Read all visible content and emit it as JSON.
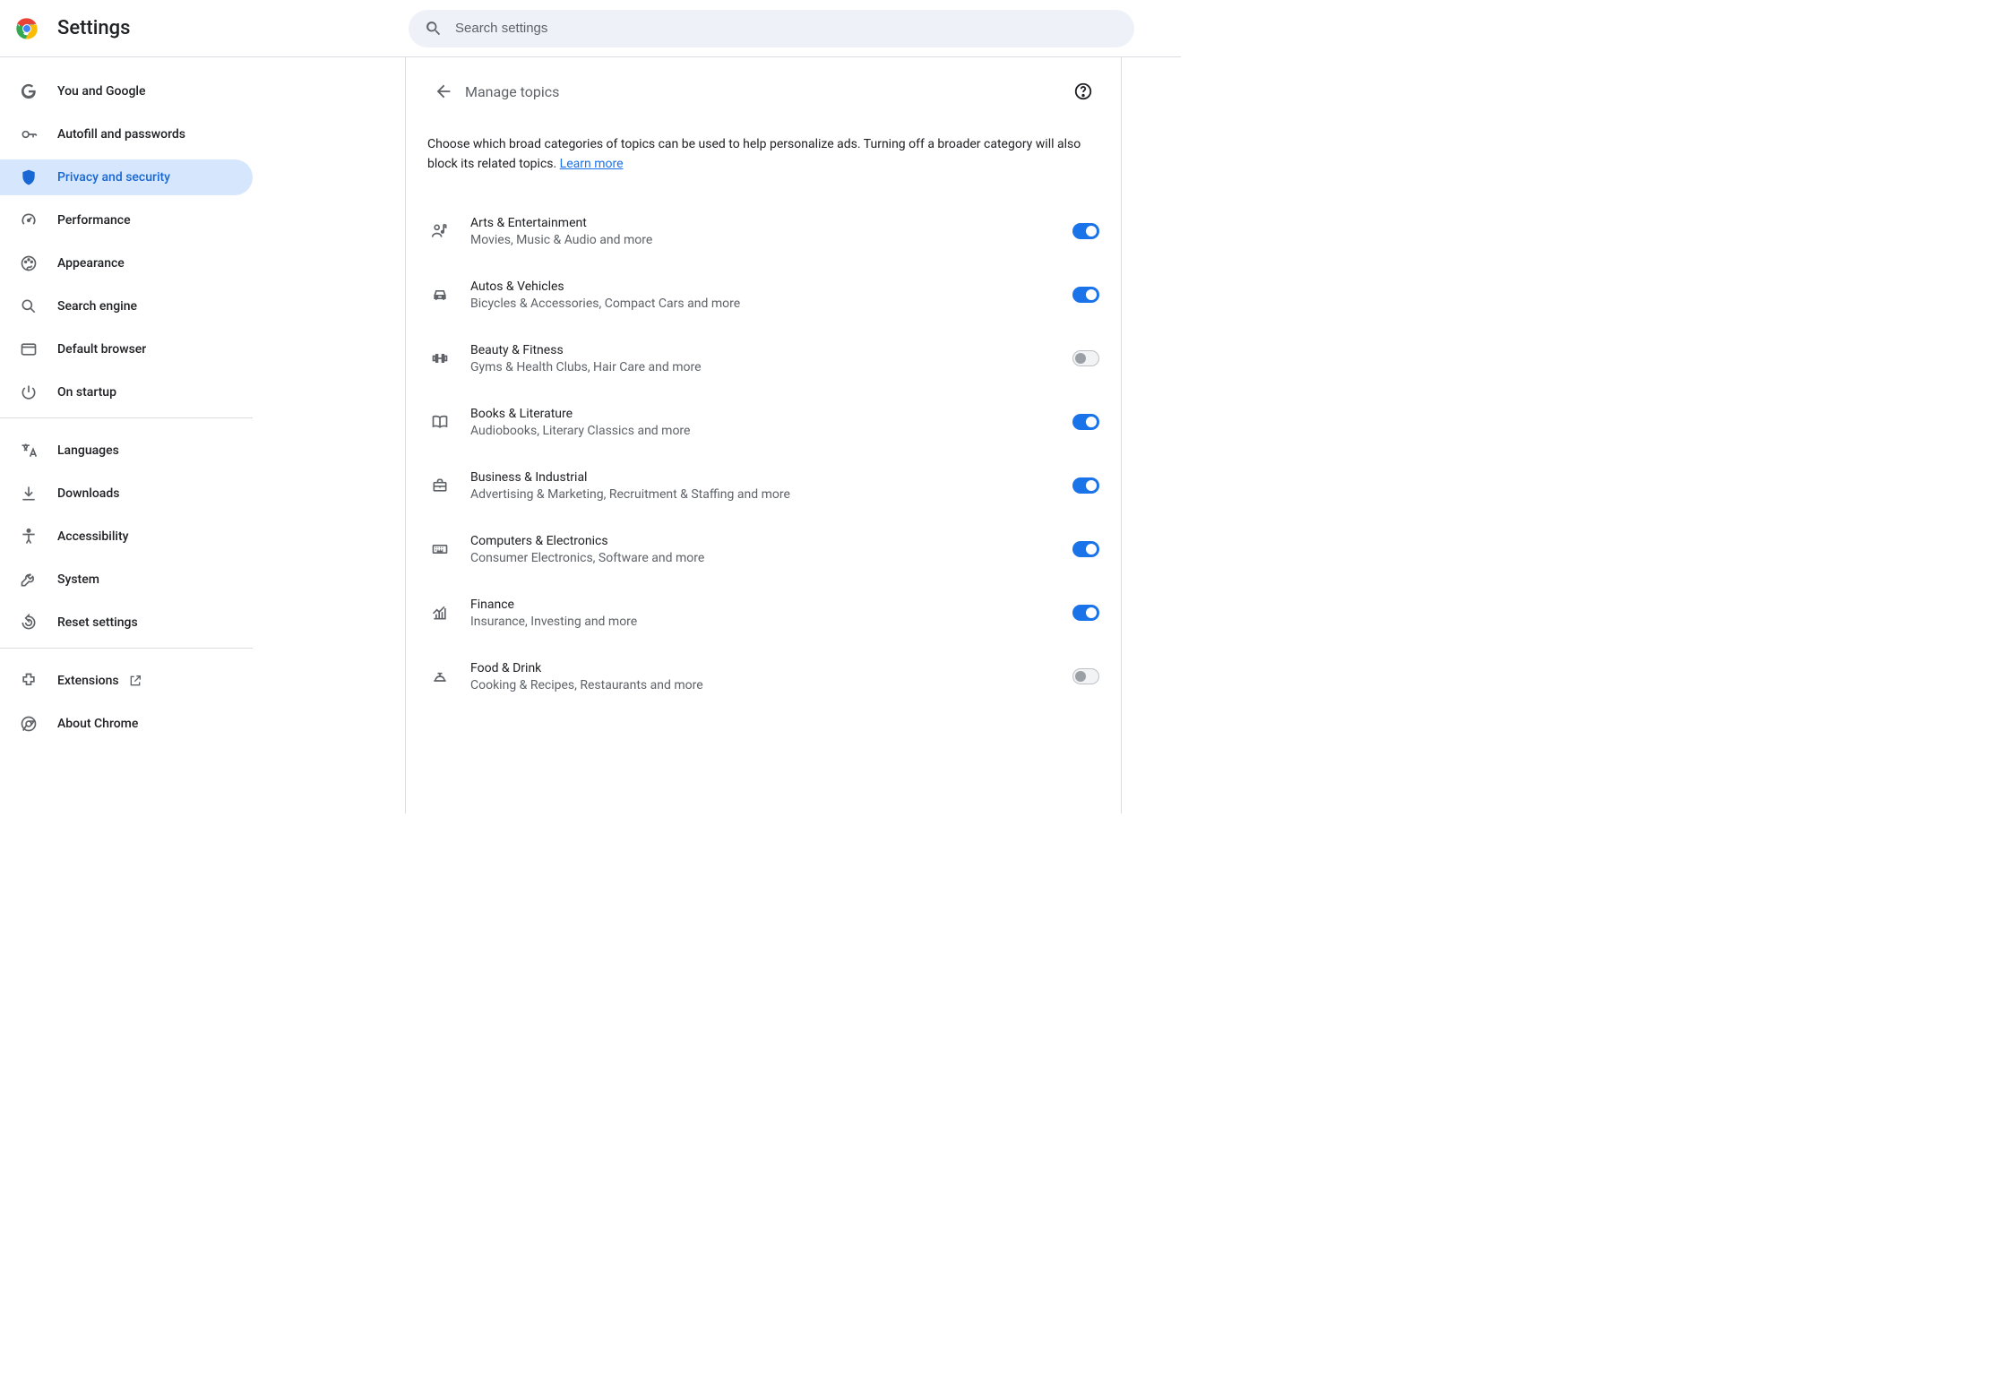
{
  "app_title": "Settings",
  "search": {
    "placeholder": "Search settings"
  },
  "sidebar": {
    "group1": [
      {
        "label": "You and Google"
      },
      {
        "label": "Autofill and passwords"
      },
      {
        "label": "Privacy and security"
      },
      {
        "label": "Performance"
      },
      {
        "label": "Appearance"
      },
      {
        "label": "Search engine"
      },
      {
        "label": "Default browser"
      },
      {
        "label": "On startup"
      }
    ],
    "group2": [
      {
        "label": "Languages"
      },
      {
        "label": "Downloads"
      },
      {
        "label": "Accessibility"
      },
      {
        "label": "System"
      },
      {
        "label": "Reset settings"
      }
    ],
    "group3": [
      {
        "label": "Extensions"
      },
      {
        "label": "About Chrome"
      }
    ]
  },
  "page": {
    "title": "Manage topics",
    "description_part1": "Choose which broad categories of topics can be used to help personalize ads. Turning off a broader category will also block its related topics. ",
    "learn_more": "Learn more"
  },
  "topics": [
    {
      "title": "Arts & Entertainment",
      "sub": "Movies, Music & Audio and more",
      "on": true
    },
    {
      "title": "Autos & Vehicles",
      "sub": "Bicycles & Accessories, Compact Cars and more",
      "on": true
    },
    {
      "title": "Beauty & Fitness",
      "sub": "Gyms & Health Clubs, Hair Care and more",
      "on": false
    },
    {
      "title": "Books & Literature",
      "sub": "Audiobooks, Literary Classics and more",
      "on": true
    },
    {
      "title": "Business & Industrial",
      "sub": "Advertising & Marketing, Recruitment & Staffing and more",
      "on": true
    },
    {
      "title": "Computers & Electronics",
      "sub": "Consumer Electronics, Software and more",
      "on": true
    },
    {
      "title": "Finance",
      "sub": "Insurance, Investing and more",
      "on": true
    },
    {
      "title": "Food & Drink",
      "sub": "Cooking & Recipes, Restaurants and more",
      "on": false
    }
  ]
}
